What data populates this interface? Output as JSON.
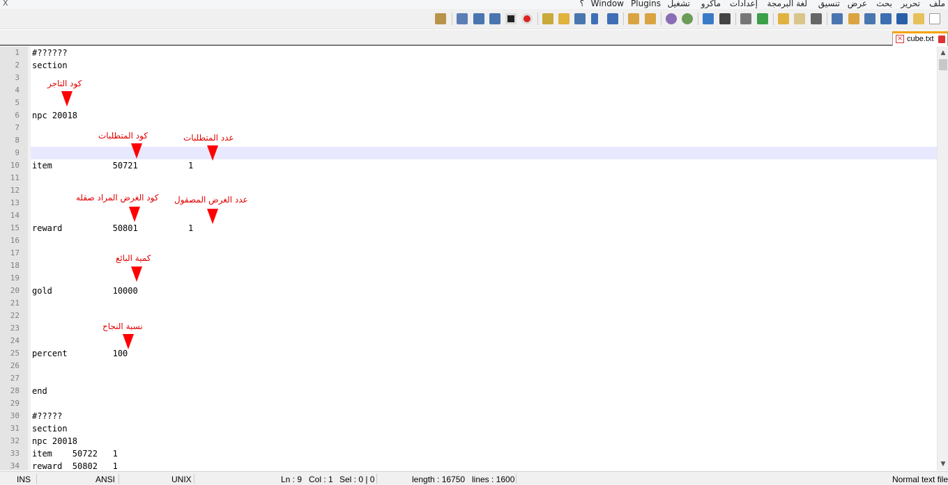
{
  "window": {
    "close_label": "X"
  },
  "menu": [
    "ملف",
    "تحرير",
    "بحث",
    "عرض",
    "تنسيق",
    "لغة البرمجة",
    "إعدادات",
    "ماكرو",
    "تشغيل",
    "Plugins",
    "Window",
    "؟"
  ],
  "toolbar_icons": [
    "new-file-icon",
    "open-file-icon",
    "save-icon",
    "save-all-icon",
    "close-icon",
    "close-all-icon",
    "print-icon",
    "cut-icon",
    "copy-icon",
    "paste-icon",
    "undo-icon",
    "redo-icon",
    "find-icon",
    "replace-icon",
    "zoom-in-icon",
    "zoom-out-icon",
    "sync-vertical-icon",
    "sync-horizontal-icon",
    "word-wrap-icon",
    "show-all-chars-icon",
    "indent-guide-icon",
    "doc-map-icon",
    "function-list-icon",
    "folder-as-workspace-icon",
    "start-recording-icon",
    "stop-recording-icon",
    "playback-icon",
    "run-multiple-icon",
    "save-macro-icon",
    "launch-browser-icon"
  ],
  "tab": {
    "label": "cube.txt"
  },
  "editor": {
    "line_numbers": [
      "1",
      "2",
      "3",
      "4",
      "5",
      "6",
      "7",
      "8",
      "9",
      "10",
      "11",
      "12",
      "13",
      "14",
      "15",
      "16",
      "17",
      "18",
      "19",
      "20",
      "21",
      "22",
      "23",
      "24",
      "25",
      "26",
      "27",
      "28",
      "29",
      "30",
      "31",
      "32",
      "33",
      "34"
    ],
    "lines": [
      {
        "n": "1",
        "text": "#??????"
      },
      {
        "n": "2",
        "text": "section"
      },
      {
        "n": "6",
        "text": "npc 20018"
      },
      {
        "n": "10",
        "text": "item            50721          1"
      },
      {
        "n": "15",
        "text": "reward          50801          1"
      },
      {
        "n": "20",
        "text": "gold            10000"
      },
      {
        "n": "25",
        "text": "percent         100"
      },
      {
        "n": "28",
        "text": "end"
      },
      {
        "n": "30",
        "text": "#?????"
      },
      {
        "n": "31",
        "text": "section"
      },
      {
        "n": "32",
        "text": "npc 20018"
      },
      {
        "n": "33",
        "text": "item    50722   1"
      },
      {
        "n": "34",
        "text": "reward  50802   1"
      }
    ],
    "annotations": [
      "كود التاجر",
      "كود المتطلبات",
      "عدد المتطلبات",
      "كود الغرض المراد صقله",
      "عدد الغرض المصقول",
      "كمية البائع",
      "نسبة النجاح"
    ]
  },
  "status": {
    "type": "Normal text file",
    "length": "length : 16750",
    "lines": "lines : 1600",
    "ln": "Ln : 9",
    "col": "Col : 1",
    "sel": "Sel : 0 | 0",
    "eol": "UNIX",
    "encoding": "ANSI",
    "mode": "INS"
  },
  "colors": {
    "annotation": "#e00000",
    "arrow": "#ff0000",
    "current_line": "#e8e8ff",
    "gutter": "#e4e4e4",
    "tab_accent": "#f6a300"
  }
}
